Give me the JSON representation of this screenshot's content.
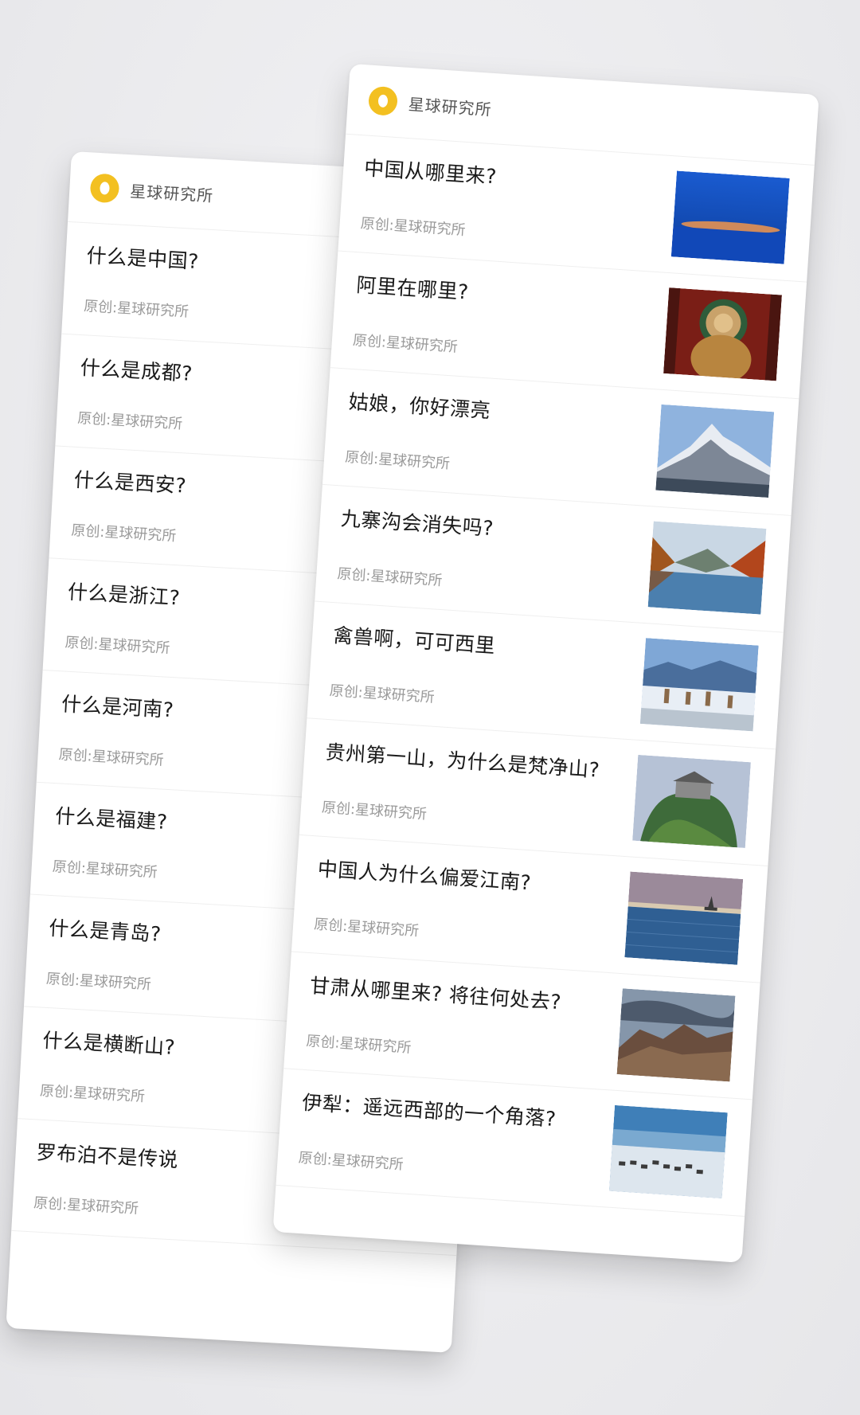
{
  "brand": {
    "name": "星球研究所",
    "logo_color": "#f3c021"
  },
  "back_card": {
    "articles": [
      {
        "title": "什么是中国?",
        "source": "原创:星球研究所"
      },
      {
        "title": "什么是成都?",
        "source": "原创:星球研究所"
      },
      {
        "title": "什么是西安?",
        "source": "原创:星球研究所"
      },
      {
        "title": "什么是浙江?",
        "source": "原创:星球研究所"
      },
      {
        "title": "什么是河南?",
        "source": "原创:星球研究所"
      },
      {
        "title": "什么是福建?",
        "source": "原创:星球研究所"
      },
      {
        "title": "什么是青岛?",
        "source": "原创:星球研究所"
      },
      {
        "title": "什么是横断山?",
        "source": "原创:星球研究所"
      },
      {
        "title": "罗布泊不是传说",
        "source": "原创:星球研究所"
      }
    ]
  },
  "front_card": {
    "articles": [
      {
        "title": "中国从哪里来?",
        "source": "原创:星球研究所",
        "image": "red-earth-over-blue-sea"
      },
      {
        "title": "阿里在哪里?",
        "source": "原创:星球研究所",
        "image": "tibetan-buddhist-mural"
      },
      {
        "title": "姑娘，你好漂亮",
        "source": "原创:星球研究所",
        "image": "snow-mountain"
      },
      {
        "title": "九寨沟会消失吗?",
        "source": "原创:星球研究所",
        "image": "autumn-lake-valley"
      },
      {
        "title": "禽兽啊，可可西里",
        "source": "原创:星球研究所",
        "image": "antelopes-on-plateau"
      },
      {
        "title": "贵州第一山，为什么是梵净山?",
        "source": "原创:星球研究所",
        "image": "temple-on-green-peak"
      },
      {
        "title": "中国人为什么偏爱江南?",
        "source": "原创:星球研究所",
        "image": "sailboat-on-lake"
      },
      {
        "title": "甘肃从哪里来? 将往何处去?",
        "source": "原创:星球研究所",
        "image": "barren-mountains"
      },
      {
        "title": "伊犁：遥远西部的一个角落?",
        "source": "原创:星球研究所",
        "image": "horses-on-snowfield"
      }
    ]
  }
}
